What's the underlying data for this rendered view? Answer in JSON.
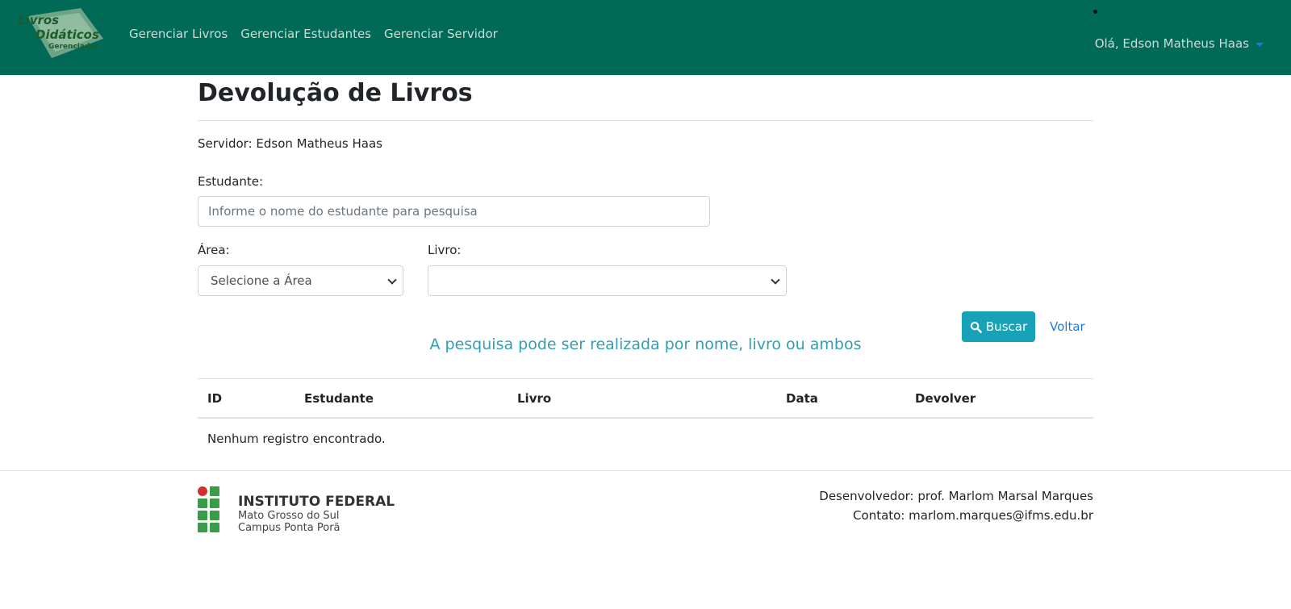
{
  "navbar": {
    "logo_text": [
      "Livros",
      "Didáticos",
      "Gerenciador"
    ],
    "links": [
      "Gerenciar Livros",
      "Gerenciar Estudantes",
      "Gerenciar Servidor"
    ],
    "user_greeting": "Olá, Edson Matheus Haas",
    "bg_color": "#006a56"
  },
  "main": {
    "title": "Devolução de Livros",
    "servidor": "Servidor: Edson Matheus Haas",
    "estudante_label": "Estudante:",
    "estudante_placeholder": "Informe o nome do estudante para pesquisa",
    "area_label": "Área:",
    "area_selected": "Selecione a Área",
    "livro_label": "Livro:",
    "livro_selected": "",
    "buscar_label": "Buscar",
    "voltar_label": "Voltar",
    "hint": "A pesquisa pode ser realizada por nome, livro ou ambos"
  },
  "table": {
    "headers": [
      "ID",
      "Estudante",
      "Livro",
      "Data",
      "Devolver"
    ],
    "empty_message": "Nenhum registro encontrado."
  },
  "footer": {
    "institution_title": "INSTITUTO FEDERAL",
    "institution_sub1": "Mato Grosso do Sul",
    "institution_sub2": "Campus Ponta Porã",
    "developer": "Desenvolvedor: prof. Marlom Marsal Marques",
    "contact": "Contato: marlom.marques@ifms.edu.br"
  }
}
